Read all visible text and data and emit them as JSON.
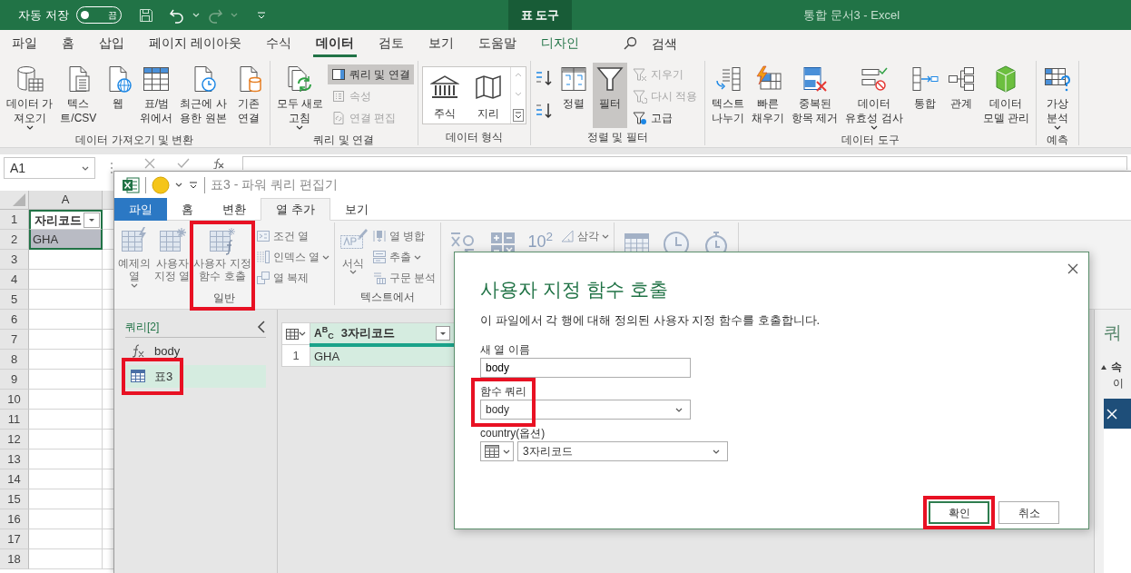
{
  "excel": {
    "autosave": {
      "label": "자동 저장",
      "on": false,
      "state_text": "끔"
    },
    "context_tab": "표 도구",
    "title": "통합 문서3  -  Excel",
    "menu_tabs": [
      {
        "label": "파일",
        "selected": false,
        "kind": "normal"
      },
      {
        "label": "홈",
        "selected": false,
        "kind": "normal"
      },
      {
        "label": "삽입",
        "selected": false,
        "kind": "normal"
      },
      {
        "label": "페이지 레이아웃",
        "selected": false,
        "kind": "normal"
      },
      {
        "label": "수식",
        "selected": false,
        "kind": "normal"
      },
      {
        "label": "데이터",
        "selected": true,
        "kind": "normal"
      },
      {
        "label": "검토",
        "selected": false,
        "kind": "normal"
      },
      {
        "label": "보기",
        "selected": false,
        "kind": "normal"
      },
      {
        "label": "도움말",
        "selected": false,
        "kind": "normal"
      },
      {
        "label": "디자인",
        "selected": false,
        "kind": "contextual"
      }
    ],
    "search": {
      "label": "검색"
    },
    "ribbon_groups": [
      {
        "label": "데이터 가져오기 및 변환",
        "items": [
          {
            "kind": "big",
            "label": "데이터 가\n져오기",
            "dropdown": true
          },
          {
            "kind": "big",
            "label": "텍스\n트/CSV"
          },
          {
            "kind": "big",
            "label": "웹"
          },
          {
            "kind": "big",
            "label": "표/범\n위에서"
          },
          {
            "kind": "big",
            "label": "최근에 사\n용한 원본"
          },
          {
            "kind": "big",
            "label": "기존\n연결"
          }
        ]
      },
      {
        "label": "쿼리 및 연결",
        "items": [
          {
            "kind": "big",
            "label": "모두 새로\n고침",
            "dropdown": true
          },
          {
            "kind": "stack",
            "items": [
              {
                "label": "쿼리 및 연결",
                "on": true,
                "disabled": false
              },
              {
                "label": "속성",
                "on": false,
                "disabled": true
              },
              {
                "label": "연결 편집",
                "on": false,
                "disabled": true
              }
            ]
          }
        ]
      },
      {
        "label": "데이터 형식",
        "items": [
          {
            "kind": "gallery",
            "items": [
              {
                "label": "주식"
              },
              {
                "label": "지리"
              }
            ]
          }
        ]
      },
      {
        "label": "정렬 및 필터",
        "items": [
          {
            "kind": "sortpair"
          },
          {
            "kind": "big",
            "label": "정렬",
            "on": false
          },
          {
            "kind": "big",
            "label": "필터",
            "on": true
          },
          {
            "kind": "stack",
            "items": [
              {
                "label": "지우기",
                "on": false,
                "disabled": true
              },
              {
                "label": "다시 적용",
                "on": false,
                "disabled": true
              },
              {
                "label": "고급",
                "on": false,
                "disabled": false
              }
            ]
          }
        ]
      },
      {
        "label": "데이터 도구",
        "items": [
          {
            "kind": "big",
            "label": "텍스트\n나누기"
          },
          {
            "kind": "big",
            "label": "빠른\n채우기"
          },
          {
            "kind": "big",
            "label": "중복된\n항목 제거"
          },
          {
            "kind": "big",
            "label": "데이터\n유효성 검사",
            "dropdown": true
          },
          {
            "kind": "big",
            "label": "통합"
          },
          {
            "kind": "big",
            "label": "관계"
          },
          {
            "kind": "big",
            "label": "데이터\n모델 관리"
          }
        ]
      },
      {
        "label": "예측",
        "items": [
          {
            "kind": "big",
            "label": "가상\n분석",
            "dropdown": true
          }
        ]
      }
    ],
    "name_box": "A1",
    "sheet": {
      "columns": [
        "A"
      ],
      "rows": [
        {
          "number": "1",
          "cells": [
            {
              "text": "자리코드",
              "kind": "header",
              "selected": true,
              "active": true
            }
          ]
        },
        {
          "number": "2",
          "cells": [
            {
              "text": "GHA",
              "kind": "data",
              "selected": true,
              "active": false
            }
          ]
        },
        {
          "number": "3"
        },
        {
          "number": "4"
        },
        {
          "number": "5"
        },
        {
          "number": "6"
        },
        {
          "number": "7"
        },
        {
          "number": "8"
        },
        {
          "number": "9"
        },
        {
          "number": "10"
        },
        {
          "number": "11"
        },
        {
          "number": "12"
        },
        {
          "number": "13"
        },
        {
          "number": "14"
        },
        {
          "number": "15"
        },
        {
          "number": "16"
        },
        {
          "number": "17"
        },
        {
          "number": "18"
        }
      ]
    }
  },
  "power_query": {
    "title": "표3 - 파워 쿼리 편집기",
    "tabs": [
      {
        "label": "파일",
        "selected": false,
        "kind": "file"
      },
      {
        "label": "홈",
        "selected": false,
        "kind": "normal"
      },
      {
        "label": "변환",
        "selected": false,
        "kind": "normal"
      },
      {
        "label": "열 추가",
        "selected": true,
        "kind": "normal"
      },
      {
        "label": "보기",
        "selected": false,
        "kind": "normal"
      }
    ],
    "ribbon_groups": [
      {
        "label": "일반",
        "items": [
          {
            "kind": "big",
            "label": "예제의\n열",
            "dropdown": true
          },
          {
            "kind": "big",
            "label": "사용자\n지정 열"
          },
          {
            "kind": "big",
            "label": "사용자 지정\n함수 호출",
            "highlighted": true
          },
          {
            "kind": "stack",
            "items": [
              {
                "label": "조건 열"
              },
              {
                "label": "인덱스 열",
                "dropdown": true
              },
              {
                "label": "열 복제"
              }
            ]
          }
        ]
      },
      {
        "label": "텍스트에서",
        "items": [
          {
            "kind": "big",
            "label": "서식",
            "dropdown": true
          },
          {
            "kind": "stack",
            "items": [
              {
                "label": "열 병합"
              },
              {
                "label": "추출",
                "dropdown": true
              },
              {
                "label": "구문 분석"
              }
            ]
          }
        ]
      },
      {
        "items": [
          {
            "kind": "icon"
          },
          {
            "kind": "icon"
          },
          {
            "kind": "rich",
            "label": "10$^{2}$"
          },
          {
            "kind": "stack",
            "items": [
              {
                "label": "삼각",
                "dropdown": true
              }
            ]
          }
        ]
      },
      {
        "items": [
          {
            "kind": "icon"
          },
          {
            "kind": "icon"
          },
          {
            "kind": "icon"
          }
        ]
      }
    ],
    "queries": {
      "title": "쿼리[2]",
      "items": [
        {
          "label": "body",
          "kind": "function",
          "selected": false
        },
        {
          "label": "표3",
          "kind": "table",
          "selected": true,
          "highlighted": true
        }
      ]
    },
    "grid": {
      "columns": [
        {
          "label": "3자리코드",
          "type_label": "A$^{B}$$_{C}$"
        }
      ],
      "rows": [
        {
          "number": "1",
          "cells": [
            "GHA"
          ]
        }
      ]
    },
    "settings_pane": {
      "title": "쿼",
      "section": "속",
      "field_label": "이"
    }
  },
  "dialog": {
    "title": "사용자 지정 함수 호출",
    "description": "이 파일에서 각 행에 대해 정의된 사용자 지정 함수를 호출합니다.",
    "fields": [
      {
        "label": "새 열 이름",
        "kind": "text",
        "value": "body"
      },
      {
        "label": "함수 쿼리",
        "kind": "select",
        "value": "body",
        "highlighted": true
      },
      {
        "label": "country(옵션)",
        "kind": "column_select",
        "value": "3자리코드"
      }
    ],
    "buttons": [
      {
        "label": "확인",
        "kind": "primary",
        "highlighted": true
      },
      {
        "label": "취소",
        "kind": "secondary"
      }
    ]
  }
}
